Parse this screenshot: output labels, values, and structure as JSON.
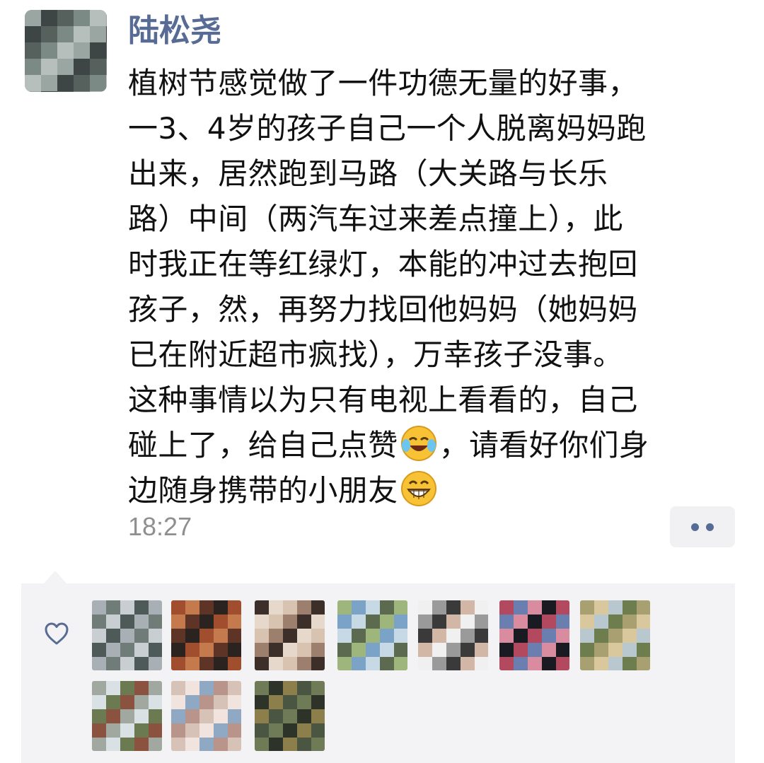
{
  "post": {
    "author": "陆松尧",
    "lines": [
      [
        {
          "t": "植树节感觉做了一件功德无量的好事，"
        }
      ],
      [
        {
          "t": "一3、4岁的孩子自己一个人脱离妈妈跑"
        }
      ],
      [
        {
          "t": "出来，居然跑到马路（大关路与长乐"
        }
      ],
      [
        {
          "t": "路）中间（两汽车过来差点撞上），此"
        }
      ],
      [
        {
          "t": "时我正在等红绿灯，本能的冲过去抱回"
        }
      ],
      [
        {
          "t": "孩子，然，再努力找回他妈妈（她妈妈"
        }
      ],
      [
        {
          "t": "已在附近超市疯找），万幸孩子没事。"
        }
      ],
      [
        {
          "t": "这种事情以为只有电视上看看的，自己"
        }
      ],
      [
        {
          "t": "碰上了，给自己点赞"
        },
        {
          "emoji": "laughing-crying-emoji"
        },
        {
          "t": "，请看好你们身"
        }
      ],
      [
        {
          "t": "边随身携带的小朋友"
        },
        {
          "emoji": "grinning-emoji"
        }
      ]
    ],
    "time": "18:27"
  },
  "icons": {
    "more": "more-dots-icon",
    "like": "heart-outline-icon"
  },
  "colors": {
    "author_name": "#576b95",
    "text": "#111111",
    "time": "#8f8f8f",
    "likes_bg": "#f3f3f5"
  },
  "likes": {
    "avatars": [
      {
        "name": "liker-avatar-1",
        "palette": [
          "#a8b0b6",
          "#6f7c78",
          "#c9ced2",
          "#4e5a57"
        ]
      },
      {
        "name": "liker-avatar-2",
        "palette": [
          "#2b2320",
          "#a04e2e",
          "#c47a4c",
          "#5e3427"
        ]
      },
      {
        "name": "liker-avatar-3",
        "palette": [
          "#d8c3b1",
          "#9c7f6d",
          "#3c2f2a",
          "#e6d8cb"
        ]
      },
      {
        "name": "liker-avatar-4",
        "palette": [
          "#7ba3c7",
          "#c8d9e6",
          "#5c6a4f",
          "#9eb57c"
        ]
      },
      {
        "name": "liker-avatar-5",
        "palette": [
          "#f0f0f0",
          "#9a9a9a",
          "#3a3a3a",
          "#d2b7a6"
        ]
      },
      {
        "name": "liker-avatar-6",
        "palette": [
          "#1a1b22",
          "#b3495f",
          "#6a7fb0",
          "#d98ca0"
        ]
      },
      {
        "name": "liker-avatar-7",
        "palette": [
          "#b9c7cf",
          "#6e7d4e",
          "#a9a071",
          "#d9c79e"
        ]
      },
      {
        "name": "liker-avatar-8",
        "palette": [
          "#d9e1e5",
          "#6c7a52",
          "#8c5240",
          "#a0a8a0"
        ]
      },
      {
        "name": "liker-avatar-9",
        "palette": [
          "#d7c2b8",
          "#f1e4de",
          "#8fa8c4",
          "#b9948a"
        ]
      },
      {
        "name": "liker-avatar-10",
        "palette": [
          "#4a5642",
          "#6f7a57",
          "#2e3329",
          "#8c7f4c"
        ]
      }
    ]
  }
}
